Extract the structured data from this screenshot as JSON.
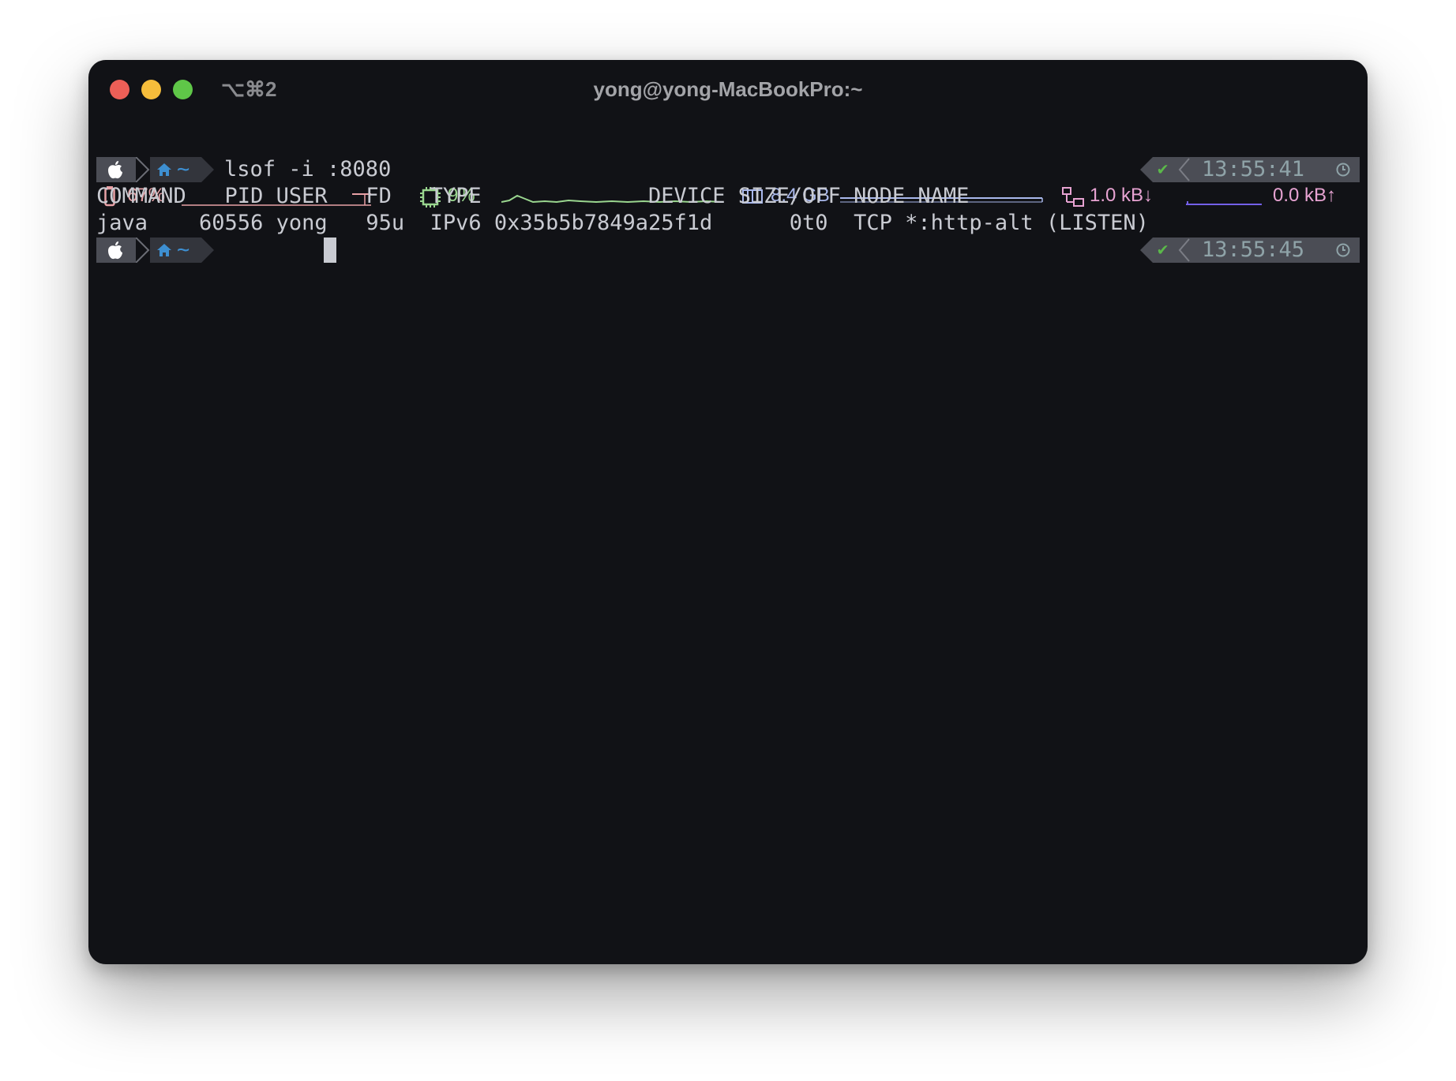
{
  "window": {
    "shortcut": "⌥⌘2",
    "title": "yong@yong-MacBookPro:~"
  },
  "status_bar": {
    "battery": {
      "icon": "battery-icon",
      "value": "67%",
      "color": "#e8a1a6"
    },
    "cpu": {
      "icon": "cpu-chip-icon",
      "value": "9%",
      "color": "#9ad68f"
    },
    "memory": {
      "icon": "memory-icon",
      "value": "8.4 GB",
      "color": "#a9b8ec"
    },
    "network_down": {
      "icon": "network-icon",
      "value": "1.0 kB↓",
      "color": "#e7a3d2"
    },
    "network_up": {
      "value": "0.0 kB↑",
      "color": "#e7a3d2"
    }
  },
  "terminal": {
    "prompts": [
      {
        "os_icon": "apple-icon",
        "dir_icon": "home-icon",
        "dir": "~",
        "command": "lsof -i :8080",
        "status_icon": "checkmark-icon",
        "time": "13:55:41",
        "clock_icon": "clock-icon"
      },
      {
        "os_icon": "apple-icon",
        "dir_icon": "home-icon",
        "dir": "~",
        "command": "",
        "status_icon": "checkmark-icon",
        "time": "13:55:45",
        "clock_icon": "clock-icon"
      }
    ],
    "output": [
      "COMMAND   PID USER   FD   TYPE             DEVICE SIZE/OFF NODE NAME",
      "java    60556 yong   95u  IPv6 0x35b5b7849a25f1d      0t0  TCP *:http-alt (LISTEN)"
    ],
    "colors": {
      "prompt_os_bg": "#4b4d55",
      "prompt_dir_bg": "#33353c",
      "dir_fg": "#3d8fd1",
      "ok": "#5bb94a",
      "time_fg": "#8fa3a8"
    }
  }
}
